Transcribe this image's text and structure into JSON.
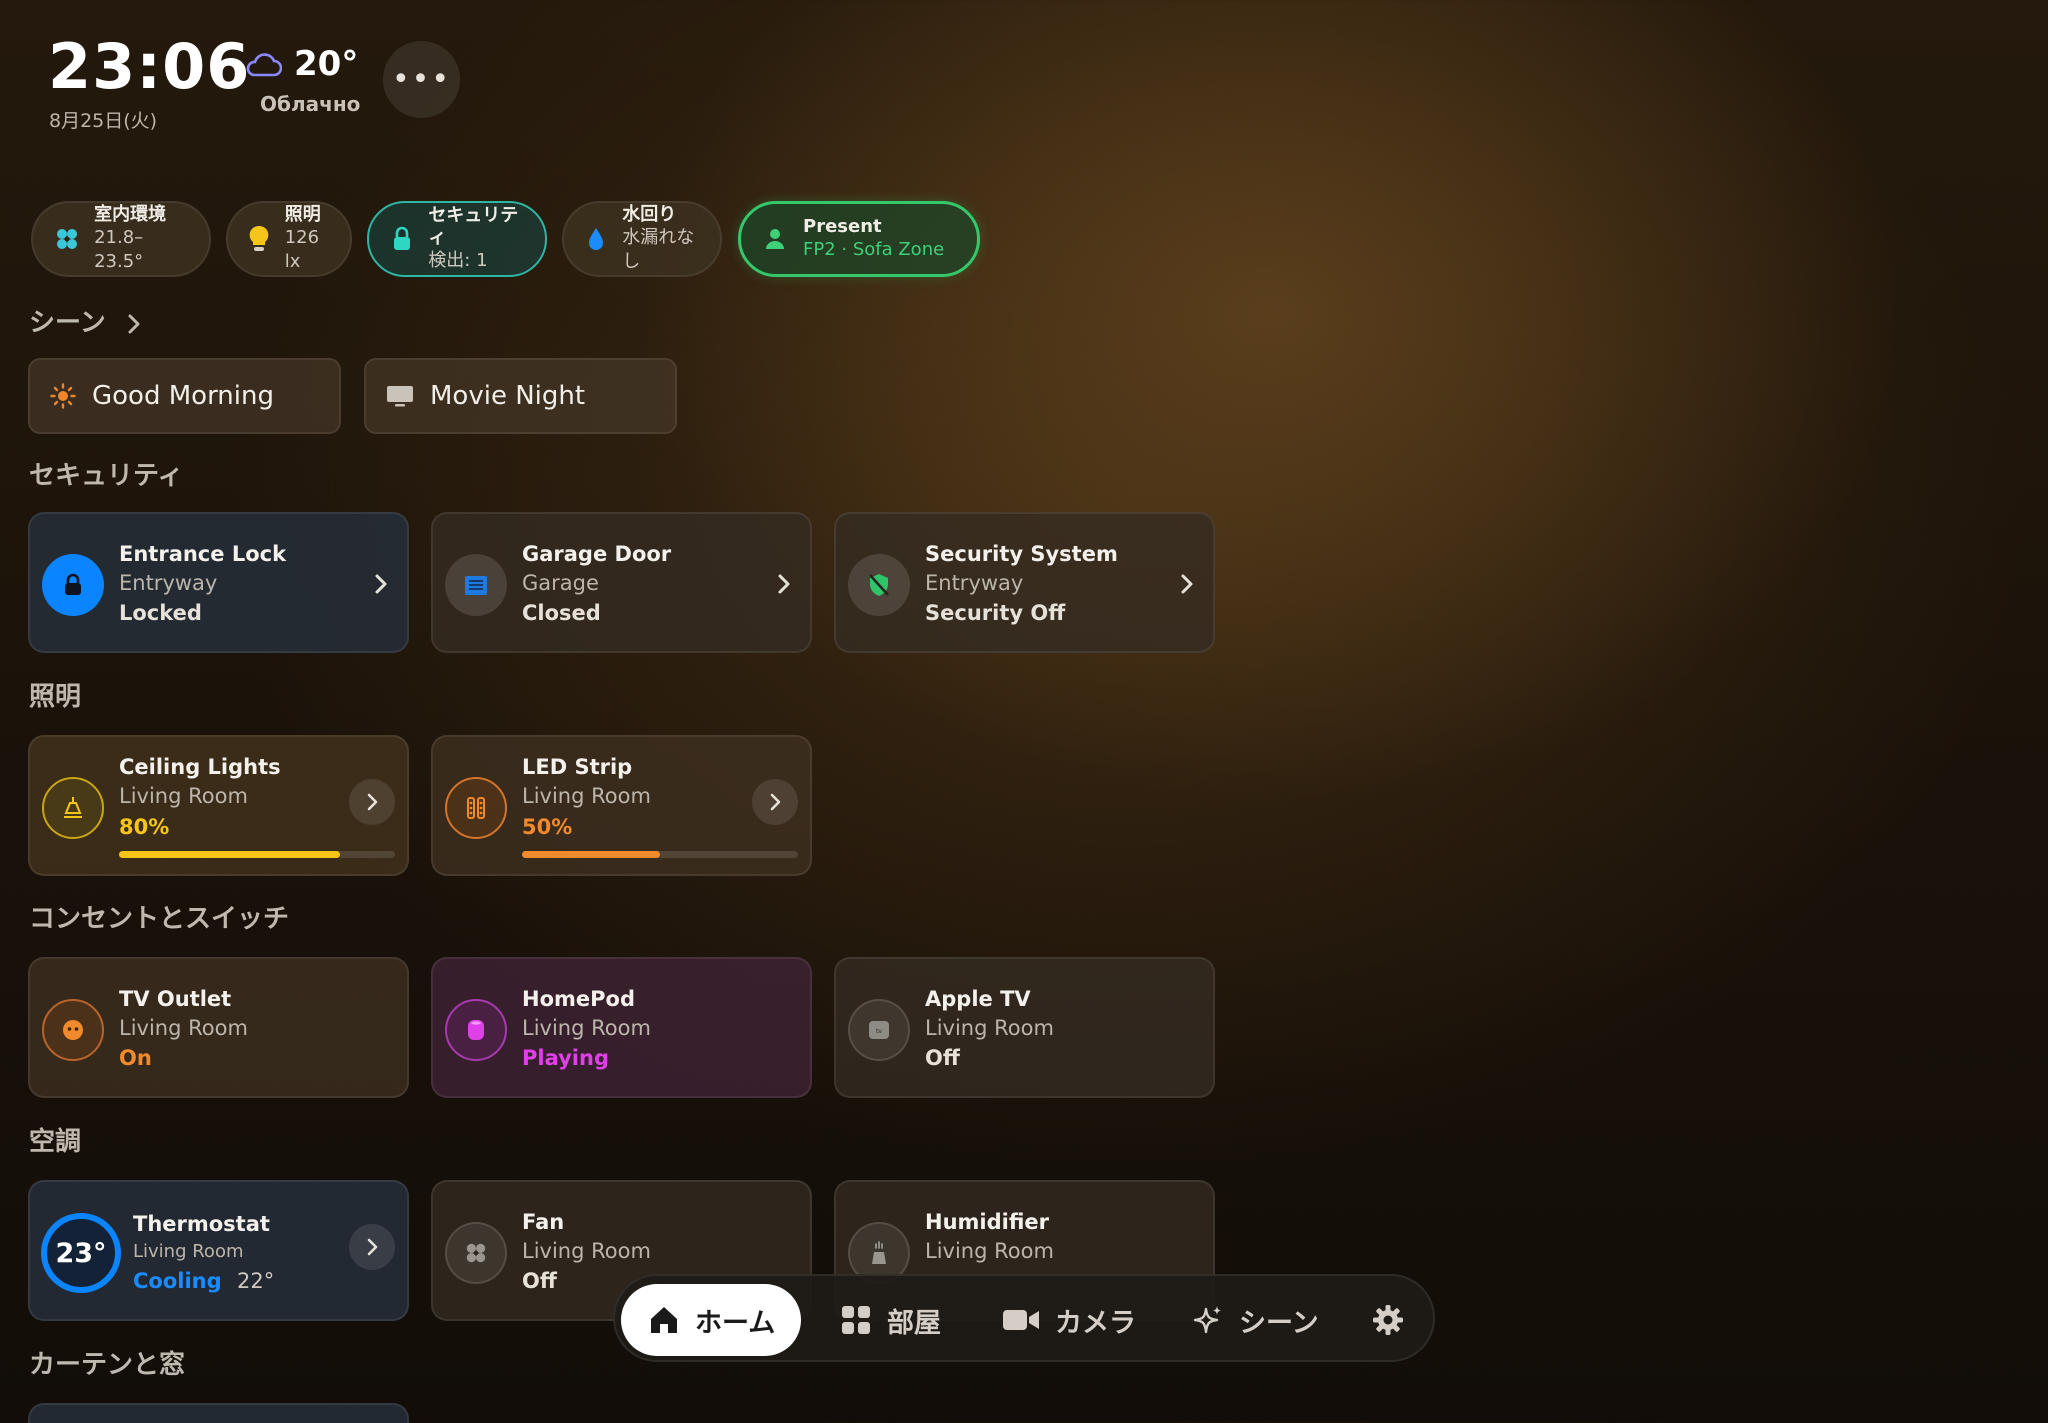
{
  "header": {
    "time": "23:06",
    "date": "8月25日(火)",
    "temperature": "20°",
    "condition": "Облачно",
    "more_label": "•••"
  },
  "status_chips": [
    {
      "icon": "fan-icon",
      "title": "室内環境",
      "value": "21.8–23.5°"
    },
    {
      "icon": "bulb-icon",
      "title": "照明",
      "value": "126 lx"
    },
    {
      "icon": "lock-icon",
      "title": "セキュリティ",
      "value": "検出: 1"
    },
    {
      "icon": "water-drop-icon",
      "title": "水回り",
      "value": "水漏れなし"
    },
    {
      "icon": "person-icon",
      "title": "Present",
      "value": "FP2 · Sofa Zone"
    }
  ],
  "sections": {
    "scenes": "シーン",
    "security": "セキュリティ",
    "lighting": "照明",
    "outlets": "コンセントとスイッチ",
    "climate": "空調",
    "curtains": "カーテンと窓"
  },
  "scenes": [
    {
      "icon": "sun-icon",
      "label": "Good Morning"
    },
    {
      "icon": "tv-icon",
      "label": "Movie Night"
    }
  ],
  "security": [
    {
      "name": "Entrance Lock",
      "room": "Entryway",
      "state": "Locked"
    },
    {
      "name": "Garage Door",
      "room": "Garage",
      "state": "Closed"
    },
    {
      "name": "Security System",
      "room": "Entryway",
      "state": "Security Off"
    }
  ],
  "lighting": [
    {
      "name": "Ceiling Lights",
      "room": "Living Room",
      "state": "80%",
      "level": 0.8
    },
    {
      "name": "LED Strip",
      "room": "Living Room",
      "state": "50%",
      "level": 0.5
    }
  ],
  "outlets": [
    {
      "name": "TV Outlet",
      "room": "Living Room",
      "state": "On"
    },
    {
      "name": "HomePod",
      "room": "Living Room",
      "state": "Playing"
    },
    {
      "name": "Apple TV",
      "room": "Living Room",
      "state": "Off"
    }
  ],
  "climate": [
    {
      "name": "Thermostat",
      "room": "Living Room",
      "current": "23°",
      "mode": "Cooling",
      "target": "22°"
    },
    {
      "name": "Fan",
      "room": "Living Room",
      "state": "Off"
    },
    {
      "name": "Humidifier",
      "room": "Living Room"
    }
  ],
  "nav": [
    {
      "icon": "home-icon",
      "label": "ホーム"
    },
    {
      "icon": "grid-icon",
      "label": "部屋"
    },
    {
      "icon": "camera-icon",
      "label": "カメラ"
    },
    {
      "icon": "sparkle-icon",
      "label": "シーン"
    },
    {
      "icon": "gear-icon",
      "label": ""
    }
  ],
  "colors": {
    "accent_blue": "#0a84ff",
    "light_yellow": "#f5c518",
    "light_orange": "#f08a2c",
    "playing_magenta": "#e040e8",
    "present_green": "#35c76b",
    "security_teal": "#2fb5a4"
  }
}
